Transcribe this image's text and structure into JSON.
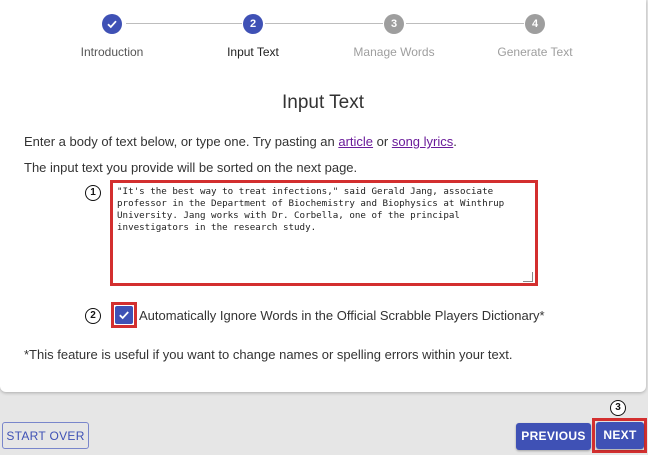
{
  "stepper": {
    "steps": [
      {
        "number": "1",
        "label": "Introduction",
        "state": "completed",
        "icon": "check-icon"
      },
      {
        "number": "2",
        "label": "Input Text",
        "state": "active"
      },
      {
        "number": "3",
        "label": "Manage Words",
        "state": "pending"
      },
      {
        "number": "4",
        "label": "Generate Text",
        "state": "pending"
      }
    ]
  },
  "main": {
    "title": "Input Text",
    "intro_prefix": "Enter a body of text below, or type one. Try pasting an ",
    "link_article": "article",
    "intro_or": " or ",
    "link_lyrics": "song lyrics",
    "intro_suffix": ".",
    "sort_note": "The input text you provide will be sorted on the next page.",
    "input_text": "\"It's the best way to treat infections,\" said Gerald Jang, associate professor in the Department of Biochemistry and Biophysics at Winthrup University. Jang works with Dr. Corbella, one of the principal investigators in the research study.",
    "checkbox_label": "Automatically Ignore Words in the Official Scrabble Players Dictionary*",
    "checkbox_checked": true,
    "footnote": "*This feature is useful if you want to change names or spelling errors within your text."
  },
  "annotations": {
    "marker_1": "1",
    "marker_2": "2",
    "marker_3": "3"
  },
  "footer": {
    "start_over": "START OVER",
    "previous": "PREVIOUS",
    "next": "NEXT"
  },
  "colors": {
    "primary": "#3f51b5",
    "pending": "#9e9e9e",
    "link": "#6a1b9a",
    "highlight": "#d32f2f"
  }
}
